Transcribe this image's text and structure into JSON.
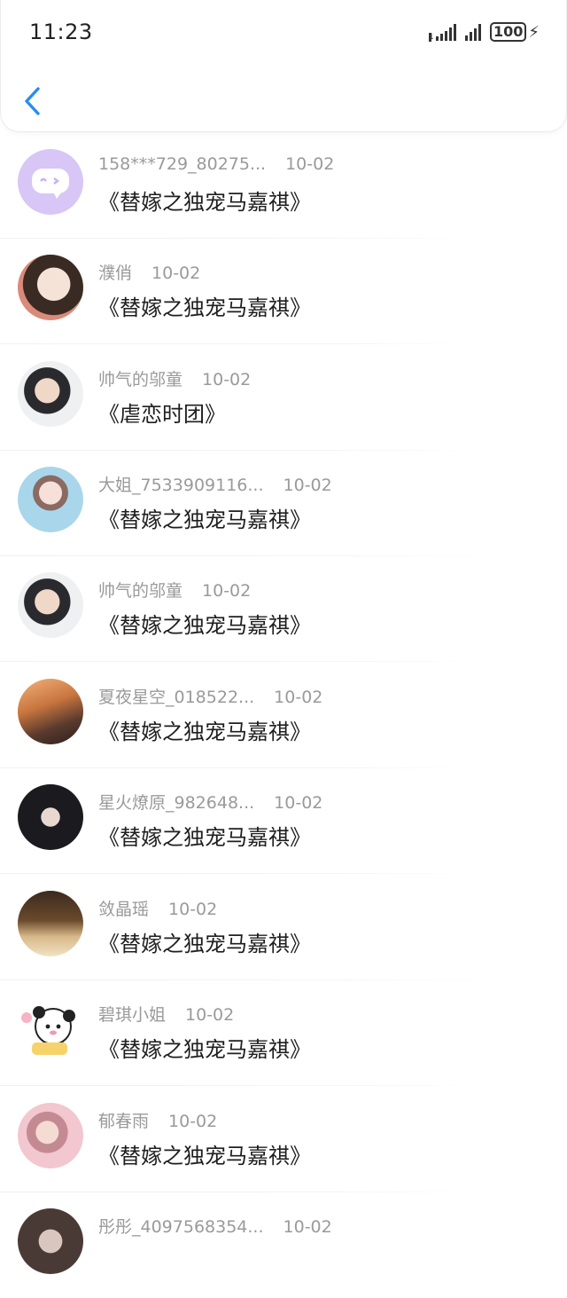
{
  "status_bar": {
    "time": "11:23",
    "battery": "100"
  },
  "items": [
    {
      "name": "158***729_80275...",
      "date": "10-02",
      "book": "《替嫁之独宠马嘉祺》",
      "avatar": "chat-bubble-avatar"
    },
    {
      "name": "濮俏",
      "date": "10-02",
      "book": "《替嫁之独宠马嘉祺》",
      "avatar": "anime-girl-avatar"
    },
    {
      "name": "帅气的邬童",
      "date": "10-02",
      "book": "《虐恋时团》",
      "avatar": "boy-photo-avatar"
    },
    {
      "name": "大姐_7533909116...",
      "date": "10-02",
      "book": "《替嫁之独宠马嘉祺》",
      "avatar": "girl-photo-avatar"
    },
    {
      "name": "帅气的邬童",
      "date": "10-02",
      "book": "《替嫁之独宠马嘉祺》",
      "avatar": "boy-photo-avatar"
    },
    {
      "name": "夏夜星空_018522...",
      "date": "10-02",
      "book": "《替嫁之独宠马嘉祺》",
      "avatar": "sunset-avatar"
    },
    {
      "name": "星火燎原_982648...",
      "date": "10-02",
      "book": "《替嫁之独宠马嘉祺》",
      "avatar": "couple-avatar"
    },
    {
      "name": "敛晶瑶",
      "date": "10-02",
      "book": "《替嫁之独宠马嘉祺》",
      "avatar": "reading-girl-avatar"
    },
    {
      "name": "碧琪小姐",
      "date": "10-02",
      "book": "《替嫁之独宠马嘉祺》",
      "avatar": "cartoon-avatar"
    },
    {
      "name": "郁春雨",
      "date": "10-02",
      "book": "《替嫁之独宠马嘉祺》",
      "avatar": "costume-avatar"
    },
    {
      "name": "彤彤_4097568354...",
      "date": "10-02",
      "book": "",
      "avatar": "partial-avatar"
    }
  ]
}
